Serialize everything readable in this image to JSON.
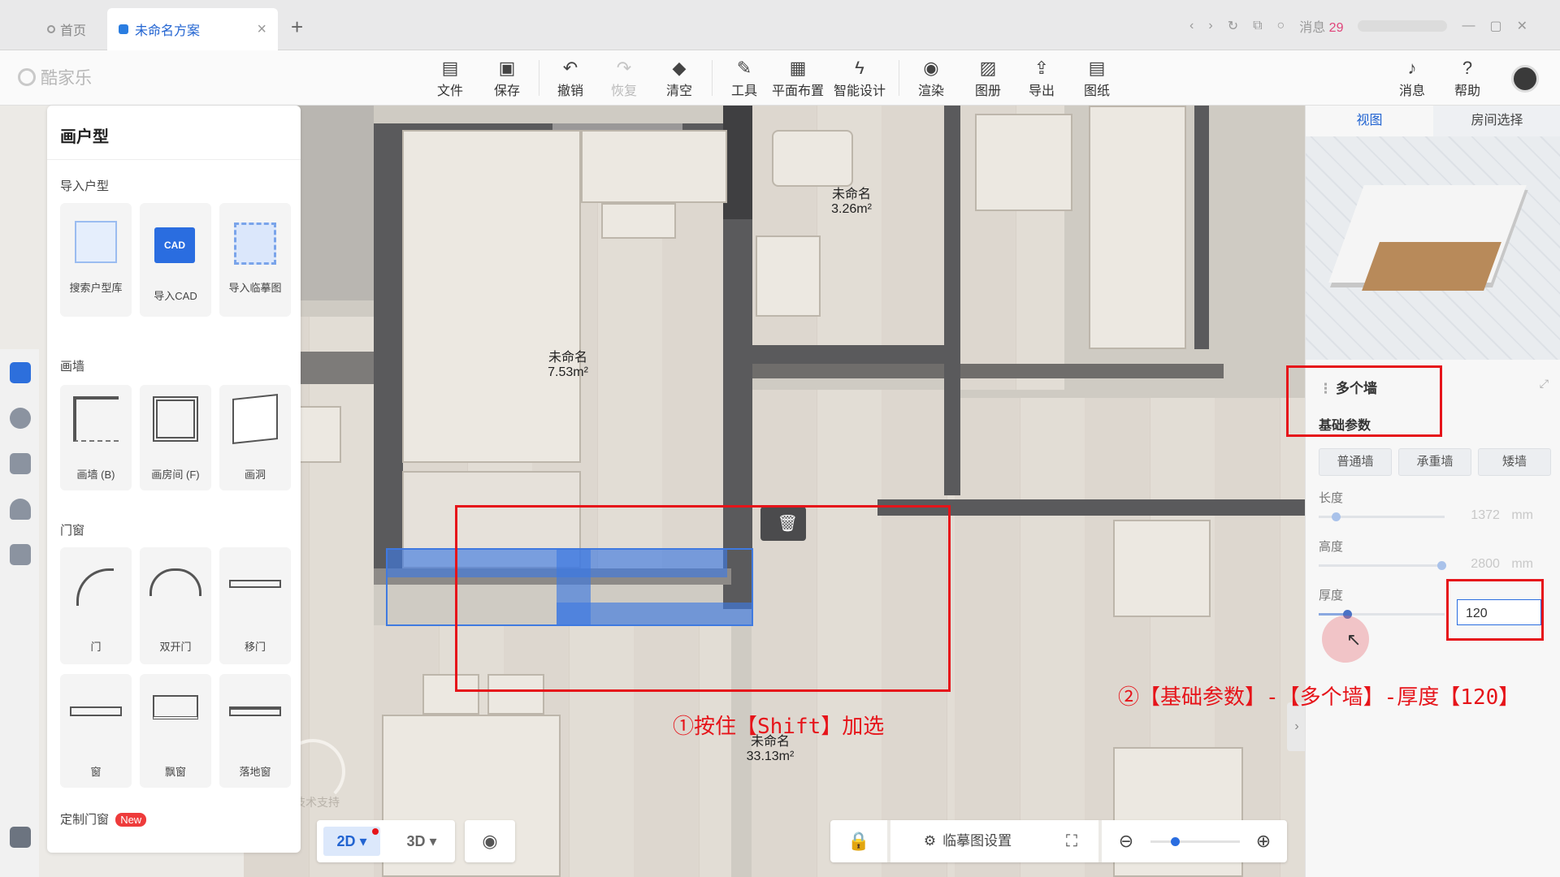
{
  "tabs": {
    "home": "首页",
    "active": "未命名方案",
    "close": "×",
    "new": "+"
  },
  "window": {
    "messages_label": "消息",
    "messages_count": "29"
  },
  "logo": "酷家乐",
  "toolbar": [
    {
      "label": "文件",
      "icon": "file-icon",
      "glyph": "▤"
    },
    {
      "label": "保存",
      "icon": "save-icon",
      "glyph": "▣"
    },
    {
      "label": "撤销",
      "icon": "undo-icon",
      "glyph": "↶"
    },
    {
      "label": "恢复",
      "icon": "redo-icon",
      "glyph": "↷"
    },
    {
      "label": "清空",
      "icon": "eraser-icon",
      "glyph": "◆"
    },
    {
      "label": "工具",
      "icon": "wrench-icon",
      "glyph": "✎"
    },
    {
      "label": "平面布置",
      "icon": "layout-icon",
      "glyph": "▦"
    },
    {
      "label": "智能设计",
      "icon": "lightning-icon",
      "glyph": "ϟ"
    },
    {
      "label": "渲染",
      "icon": "render-icon",
      "glyph": "◉"
    },
    {
      "label": "图册",
      "icon": "album-icon",
      "glyph": "▨"
    },
    {
      "label": "导出",
      "icon": "export-icon",
      "glyph": "⇪"
    },
    {
      "label": "图纸",
      "icon": "drawing-icon",
      "glyph": "▤"
    },
    {
      "label": "消息",
      "icon": "bell-icon",
      "glyph": "♪"
    },
    {
      "label": "帮助",
      "icon": "help-icon",
      "glyph": "?"
    }
  ],
  "left_panel": {
    "title": "画户型",
    "sections": {
      "import": "导入户型",
      "walls": "画墙",
      "doors": "门窗",
      "custom": "定制门窗",
      "new_badge": "New"
    },
    "import_items": [
      "搜索户型库",
      "导入CAD",
      "导入临摹图"
    ],
    "cad_badge": "CAD",
    "wall_items": [
      "画墙 (B)",
      "画房间 (F)",
      "画洞"
    ],
    "door_items": [
      "门",
      "双开门",
      "移门",
      "窗",
      "飘窗",
      "落地窗"
    ]
  },
  "canvas": {
    "rooms": [
      {
        "name": "未命名",
        "area": "3.26m²"
      },
      {
        "name": "未命名",
        "area": "7.53m²"
      },
      {
        "name": "未命名",
        "area": "33.13m²"
      }
    ],
    "watermark": "酷家乐技术支持"
  },
  "right_panel": {
    "tabs": [
      "视图",
      "房间选择"
    ],
    "section_title": "多个墙",
    "basic_params": "基础参数",
    "wall_types": [
      "普通墙",
      "承重墙",
      "矮墙"
    ],
    "params": [
      {
        "label": "长度",
        "value": "1372",
        "unit": "mm"
      },
      {
        "label": "高度",
        "value": "2800",
        "unit": "mm"
      },
      {
        "label": "厚度",
        "value": "120",
        "unit": ""
      }
    ]
  },
  "annotations": {
    "step1": "①按住【Shift】加选",
    "step2": "②【基础参数】-【多个墙】-厚度【120】"
  },
  "bottom": {
    "mode_2d": "2D",
    "mode_3d": "3D",
    "trace_settings": "临摹图设置",
    "zoom_level": 0.27
  },
  "colors": {
    "accent": "#2264d1",
    "annotation": "#e6141a",
    "selection": "#3f7ae0"
  }
}
